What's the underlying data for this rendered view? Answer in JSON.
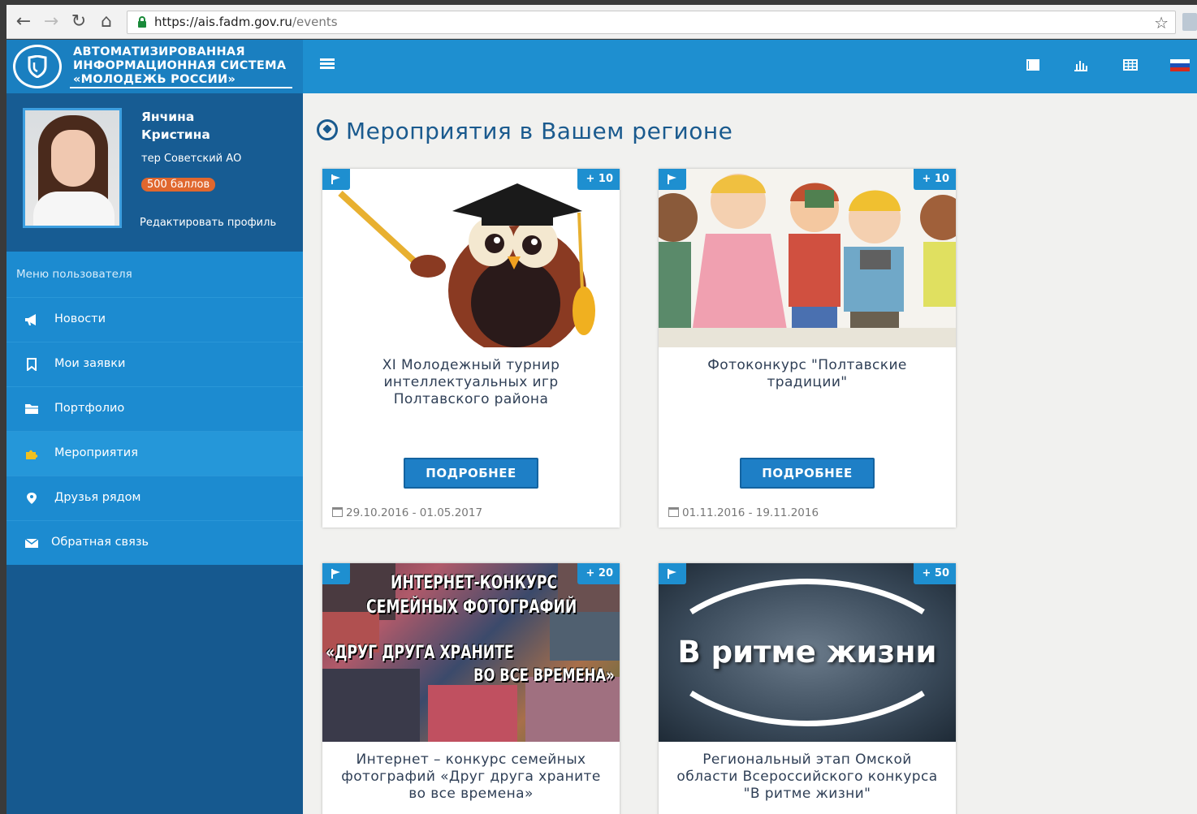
{
  "browser": {
    "url_host": "https://ais.fadm.gov.ru",
    "url_path": "/events"
  },
  "brand": {
    "line1": "АВТОМАТИЗИРОВАННАЯ",
    "line2": "ИНФОРМАЦИОННАЯ СИСТЕМА",
    "line3": "«МОЛОДЕЖЬ РОССИИ»"
  },
  "profile": {
    "first_line": "Янчина",
    "second_line": "Кристина",
    "region": "тер Советский АО",
    "points": "500 баллов",
    "edit_label": "Редактировать профиль"
  },
  "menu": {
    "heading": "Меню пользователя",
    "items": [
      {
        "label": "Новости",
        "icon": "megaphone-icon"
      },
      {
        "label": "Мои заявки",
        "icon": "bookmark-icon"
      },
      {
        "label": "Портфолио",
        "icon": "folder-icon"
      },
      {
        "label": "Мероприятия",
        "icon": "puzzle-icon",
        "active": true
      },
      {
        "label": "Друзья рядом",
        "icon": "map-marker-icon"
      },
      {
        "label": "Обратная связь",
        "icon": "envelope-icon"
      }
    ]
  },
  "page": {
    "title": "Мероприятия в Вашем регионе"
  },
  "events": [
    {
      "title": "XI Молодежный турнир интеллектуальных игр Полтавского района",
      "points": "+ 10",
      "dates": "29.10.2016 - 01.05.2017",
      "button": "ПОДРОБНЕЕ"
    },
    {
      "title": "Фотоконкурс \"Полтавские традиции\"",
      "points": "+ 10",
      "dates": "01.11.2016 - 19.11.2016",
      "button": "ПОДРОБНЕЕ"
    },
    {
      "title": "Интернет – конкурс семейных фотографий «Друг друга храните во все времена»",
      "points": "+ 20"
    },
    {
      "title": "Региональный этап Омской области Всероссийского конкурса \"В ритме жизни\"",
      "points": "+ 50"
    }
  ],
  "image_text": {
    "collage_line1": "ИНТЕРНЕТ-КОНКУРС",
    "collage_line2": "СЕМЕЙНЫХ ФОТОГРАФИЙ",
    "collage_line3": "«ДРУГ ДРУГА ХРАНИТЕ",
    "collage_line4": "ВО ВСЕ ВРЕМЕНА»",
    "rhythm": "В ритме жизни"
  },
  "colors": {
    "header_blue": "#1e8fd0",
    "sidebar_dark": "#16598f",
    "points_orange": "#e0672e",
    "title_blue": "#1a5a8e"
  }
}
